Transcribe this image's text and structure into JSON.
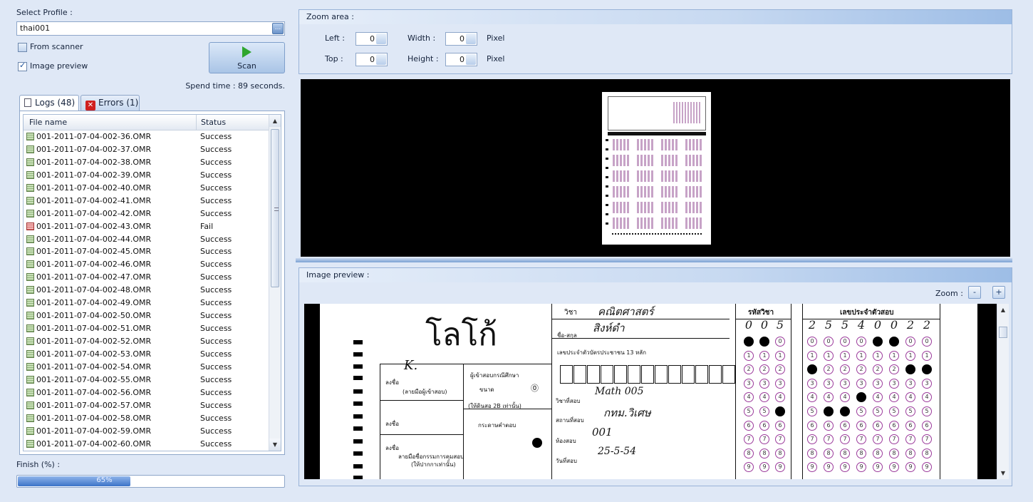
{
  "left": {
    "select_profile_label": "Select Profile :",
    "profile_value": "thai001",
    "profile_button_glyph": "...",
    "from_scanner_label": "From scanner",
    "from_scanner_checked": false,
    "image_preview_label": "Image preview",
    "image_preview_checked": true,
    "scan_label": "Scan",
    "spend_time": "Spend time : 89 seconds.",
    "tabs": [
      {
        "label": "Logs (48)",
        "active": true,
        "icon": "log-icon"
      },
      {
        "label": "Errors (1)",
        "active": false,
        "icon": "error-icon"
      }
    ],
    "columns": [
      "File name",
      "Status"
    ],
    "rows": [
      {
        "file": "001-2011-07-04-002-36.OMR",
        "status": "Success"
      },
      {
        "file": "001-2011-07-04-002-37.OMR",
        "status": "Success"
      },
      {
        "file": "001-2011-07-04-002-38.OMR",
        "status": "Success"
      },
      {
        "file": "001-2011-07-04-002-39.OMR",
        "status": "Success"
      },
      {
        "file": "001-2011-07-04-002-40.OMR",
        "status": "Success"
      },
      {
        "file": "001-2011-07-04-002-41.OMR",
        "status": "Success"
      },
      {
        "file": "001-2011-07-04-002-42.OMR",
        "status": "Success"
      },
      {
        "file": "001-2011-07-04-002-43.OMR",
        "status": "Fail"
      },
      {
        "file": "001-2011-07-04-002-44.OMR",
        "status": "Success"
      },
      {
        "file": "001-2011-07-04-002-45.OMR",
        "status": "Success"
      },
      {
        "file": "001-2011-07-04-002-46.OMR",
        "status": "Success"
      },
      {
        "file": "001-2011-07-04-002-47.OMR",
        "status": "Success"
      },
      {
        "file": "001-2011-07-04-002-48.OMR",
        "status": "Success"
      },
      {
        "file": "001-2011-07-04-002-49.OMR",
        "status": "Success"
      },
      {
        "file": "001-2011-07-04-002-50.OMR",
        "status": "Success"
      },
      {
        "file": "001-2011-07-04-002-51.OMR",
        "status": "Success"
      },
      {
        "file": "001-2011-07-04-002-52.OMR",
        "status": "Success"
      },
      {
        "file": "001-2011-07-04-002-53.OMR",
        "status": "Success"
      },
      {
        "file": "001-2011-07-04-002-54.OMR",
        "status": "Success"
      },
      {
        "file": "001-2011-07-04-002-55.OMR",
        "status": "Success"
      },
      {
        "file": "001-2011-07-04-002-56.OMR",
        "status": "Success"
      },
      {
        "file": "001-2011-07-04-002-57.OMR",
        "status": "Success"
      },
      {
        "file": "001-2011-07-04-002-58.OMR",
        "status": "Success"
      },
      {
        "file": "001-2011-07-04-002-59.OMR",
        "status": "Success"
      },
      {
        "file": "001-2011-07-04-002-60.OMR",
        "status": "Success"
      }
    ],
    "finish_label": "Finish (%) :",
    "progress_text": "65%",
    "progress_fraction": 0.65
  },
  "zoom_area": {
    "title": "Zoom area :",
    "left_label": "Left :",
    "left_value": "0",
    "top_label": "Top :",
    "top_value": "0",
    "width_label": "Width :",
    "width_value": "0",
    "height_label": "Height :",
    "height_value": "0",
    "unit1": "Pixel",
    "unit2": "Pixel"
  },
  "image_preview": {
    "title": "Image preview :",
    "zoom_label": "Zoom :",
    "zoom_out": "-",
    "zoom_in": "+"
  },
  "sheet": {
    "logo": "โลโก้",
    "subject_label": "วิชา",
    "subject_value": "คณิตศาสตร์",
    "name_label": "ชื่อ-สกุล",
    "name_value": "สิงห์ดำ",
    "id_label": "เลขประจำตัวบัตรประชาชน 13 หลัก",
    "exam_subject_label": "วิชาที่สอบ",
    "exam_subject_value": "Math 005",
    "venue_label": "สถานที่สอบ",
    "venue_value": "กทม.วิเศษ",
    "room_label": "ห้องสอบ",
    "room_value": "001",
    "date_label": "วันที่สอบ",
    "date_value": "25-5-54",
    "subject_code_header": "รหัสวิชา",
    "subject_code_digits": [
      "0",
      "0",
      "5"
    ],
    "seat_header": "เลขประจำตัวสอบ",
    "seat_digits": [
      "2",
      "5",
      "5",
      "4",
      "0",
      "0",
      "2",
      "2"
    ],
    "sign_label": "ลงชื่อ",
    "sign_caption": "(ลายมือผู้เข้าสอบ)",
    "sign2_label": "ลงชื่อ",
    "sign3_label": "ลงชื่อ",
    "proctor_caption": "ลายมือชื่อกรรมการคุมสอบ",
    "proctor_caption2": "(ให้ปากกาเท่านั้น)",
    "pencil_header": "ผู้เข้าสอบกรณีศึกษา",
    "pencil_label": "ขนาด",
    "pencil_note": "(ให้ดินสอ 2B เท่านั้น)",
    "return_label": "กระดาษคำตอบ"
  },
  "colors": {
    "panel_bg": "#dfe8f6",
    "bubble_border": "#9b3a9b",
    "progress": "#3c74c8"
  }
}
